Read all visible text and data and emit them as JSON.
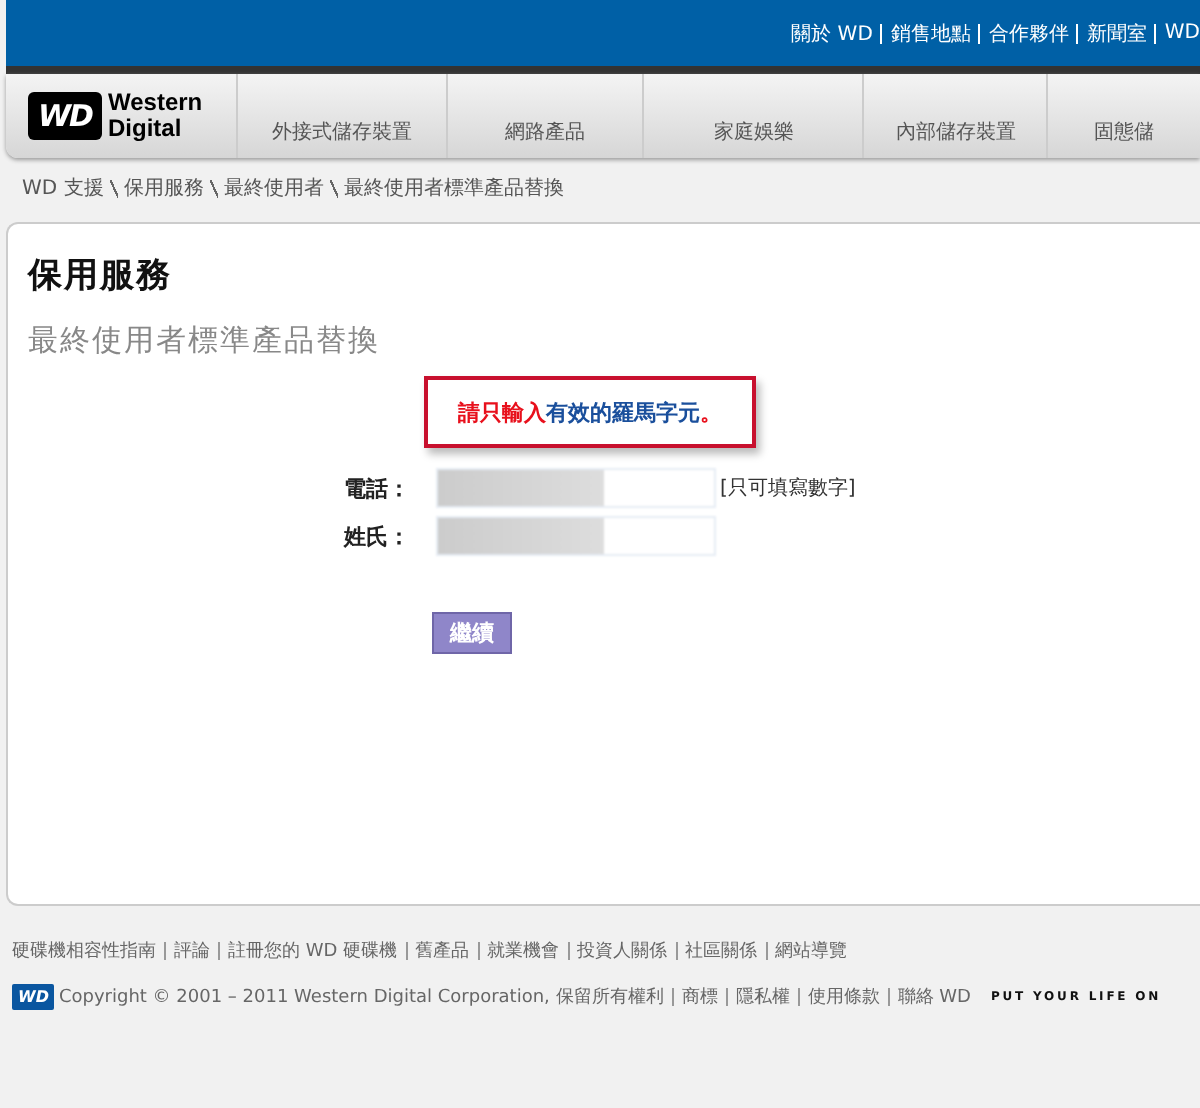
{
  "top_links": [
    "關於 WD",
    "銷售地點",
    "合作夥伴",
    "新聞室",
    "WD"
  ],
  "logo": {
    "line1": "Western",
    "line2": "Digital",
    "mark": "WD"
  },
  "nav": [
    "外接式儲存裝置",
    "網路產品",
    "家庭娛樂",
    "內部儲存裝置",
    "固態儲"
  ],
  "breadcrumb": [
    "WD 支援",
    "保用服務",
    "最終使用者",
    "最終使用者標準產品替換"
  ],
  "page_title": "保用服務",
  "subtitle": "最終使用者標準產品替換",
  "error": [
    {
      "text": "請只輸入",
      "color": "#e8101c"
    },
    {
      "text": "有效的羅馬字元",
      "color": "#1a4f9c"
    },
    {
      "text": "。",
      "color": "#e8101c"
    }
  ],
  "form": [
    {
      "label": "電話：",
      "hint": "[只可填寫數字]"
    },
    {
      "label": "姓氏："
    }
  ],
  "continue_button": "繼續",
  "footer_links": [
    "硬碟機相容性指南",
    "評論",
    "註冊您的 WD 硬碟機",
    "舊產品",
    "就業機會",
    "投資人關係",
    "社區關係",
    "網站導覽"
  ],
  "copyright": "Copyright © 2001 – 2011 Western Digital Corporation, 保留所有權利",
  "legal_links": [
    "商標",
    "隱私權",
    "使用條款",
    "聯絡 WD"
  ],
  "footer_logo": "WD",
  "tagline": "PUT YOUR LIFE ON"
}
